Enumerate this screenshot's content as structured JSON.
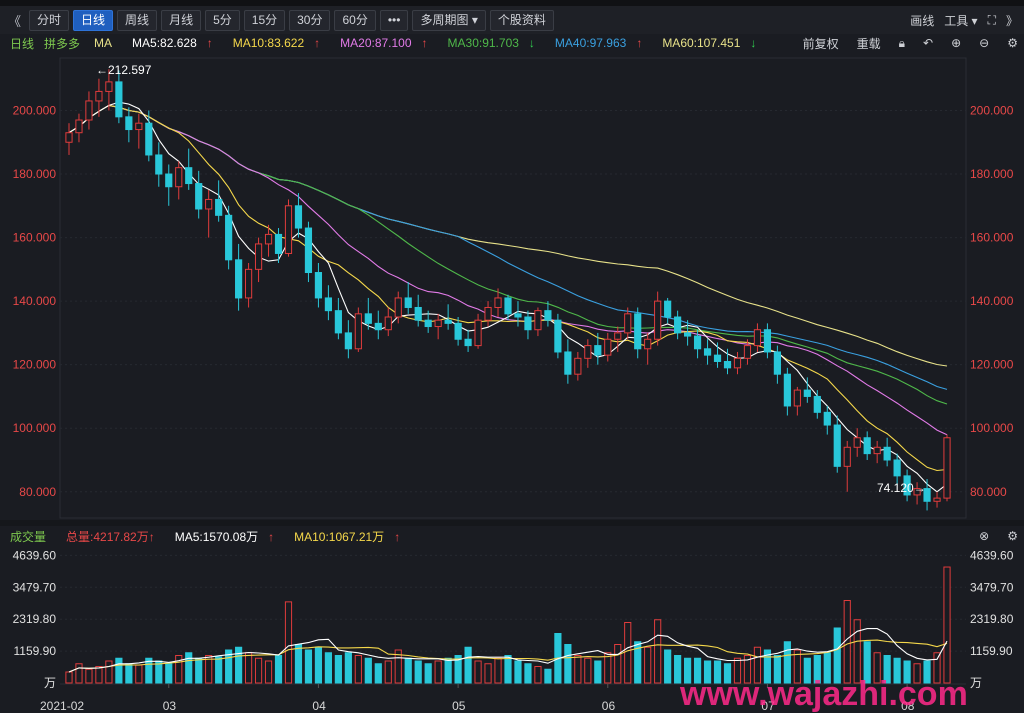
{
  "toolbar": {
    "nav_left": "《",
    "tabs": [
      "分时",
      "日线",
      "周线",
      "月线",
      "5分",
      "15分",
      "30分",
      "60分"
    ],
    "active_tab": 1,
    "more": "•••",
    "multi_period": "多周期图",
    "stock_info": "个股资料",
    "draw_line": "画线",
    "tools": "工具",
    "nav_right": "》"
  },
  "indicators": {
    "period_label": "日线",
    "stock_name": "拼多多",
    "ma_label": "MA",
    "ma5": "MA5:82.628",
    "ma10": "MA10:83.622",
    "ma20": "MA20:87.100",
    "ma30": "MA30:91.703",
    "ma40": "MA40:97.963",
    "ma60": "MA60:107.451",
    "right_labels": [
      "前复权",
      "重载"
    ]
  },
  "colors": {
    "up": "#e03c3c",
    "down": "#29c7d9",
    "ma5": "#ffffff",
    "ma10": "#f5d84b",
    "ma20": "#e27be8",
    "ma30": "#4fb84a",
    "ma40": "#3aa0e0",
    "ma60": "#e8e28a",
    "axis_text": "#e84848",
    "header_green": "#7ec94f"
  },
  "price_axis": {
    "labels": [
      "200.000",
      "180.000",
      "160.000",
      "140.000",
      "120.000",
      "100.000",
      "80.000"
    ],
    "values": [
      200,
      180,
      160,
      140,
      120,
      100,
      80
    ],
    "min": 73,
    "max": 214
  },
  "annotations": {
    "high": "←212.597",
    "low": "74.120→"
  },
  "volume": {
    "title": "成交量",
    "total": "总量:4217.82万",
    "ma5": "MA5:1570.08万",
    "ma10": "MA10:1067.21万",
    "axis_labels": [
      "4639.60",
      "3479.70",
      "2319.80",
      "1159.90",
      "万"
    ],
    "axis_values": [
      4639.6,
      3479.7,
      2319.8,
      1159.9,
      0
    ],
    "max": 4800
  },
  "date_axis": [
    "2021-02",
    "03",
    "04",
    "05",
    "06",
    "07",
    "08"
  ],
  "watermark": "www.wajazhi.com",
  "chart_data": {
    "type": "candlestick",
    "title": "拼多多 日线",
    "high_marker": 212.597,
    "low_marker": 74.12,
    "x": [
      "2021-02",
      "03",
      "04",
      "05",
      "06",
      "07",
      "08"
    ],
    "ohlc": [
      [
        190,
        196,
        186,
        193
      ],
      [
        193,
        199,
        190,
        197
      ],
      [
        197,
        206,
        194,
        203
      ],
      [
        203,
        210,
        198,
        206
      ],
      [
        206,
        213,
        200,
        209
      ],
      [
        209,
        212.6,
        196,
        198
      ],
      [
        198,
        201,
        190,
        194
      ],
      [
        194,
        199,
        188,
        196
      ],
      [
        196,
        200,
        184,
        186
      ],
      [
        186,
        190,
        176,
        180
      ],
      [
        180,
        183,
        170,
        176
      ],
      [
        176,
        184,
        172,
        182
      ],
      [
        182,
        188,
        175,
        177
      ],
      [
        177,
        181,
        166,
        169
      ],
      [
        169,
        175,
        160,
        172
      ],
      [
        172,
        178,
        165,
        167
      ],
      [
        167,
        170,
        150,
        153
      ],
      [
        153,
        158,
        137,
        141
      ],
      [
        141,
        152,
        138,
        150
      ],
      [
        150,
        160,
        146,
        158
      ],
      [
        158,
        164,
        154,
        161
      ],
      [
        161,
        163,
        152,
        155
      ],
      [
        155,
        172,
        154,
        170
      ],
      [
        170,
        174,
        160,
        163
      ],
      [
        163,
        165,
        146,
        149
      ],
      [
        149,
        152,
        138,
        141
      ],
      [
        141,
        145,
        134,
        137
      ],
      [
        137,
        141,
        128,
        130
      ],
      [
        130,
        134,
        122,
        125
      ],
      [
        125,
        138,
        124,
        136
      ],
      [
        136,
        141,
        131,
        133
      ],
      [
        133,
        137,
        128,
        131
      ],
      [
        131,
        138,
        129,
        135
      ],
      [
        135,
        143,
        133,
        141
      ],
      [
        141,
        146,
        136,
        138
      ],
      [
        138,
        142,
        132,
        134
      ],
      [
        134,
        137,
        130,
        132
      ],
      [
        132,
        136,
        128,
        134
      ],
      [
        134,
        139,
        131,
        133
      ],
      [
        133,
        135,
        126,
        128
      ],
      [
        128,
        131,
        124,
        126
      ],
      [
        126,
        136,
        125,
        134
      ],
      [
        134,
        140,
        132,
        138
      ],
      [
        138,
        144,
        135,
        141
      ],
      [
        141,
        142,
        134,
        136
      ],
      [
        136,
        140,
        132,
        135
      ],
      [
        135,
        137,
        128,
        131
      ],
      [
        131,
        138,
        129,
        137
      ],
      [
        137,
        140,
        132,
        134
      ],
      [
        134,
        136,
        122,
        124
      ],
      [
        124,
        128,
        114,
        117
      ],
      [
        117,
        124,
        115,
        122
      ],
      [
        122,
        128,
        119,
        126
      ],
      [
        126,
        130,
        120,
        123
      ],
      [
        123,
        130,
        121,
        128
      ],
      [
        128,
        132,
        124,
        130
      ],
      [
        130,
        138,
        128,
        136
      ],
      [
        136,
        138,
        122,
        125
      ],
      [
        125,
        130,
        120,
        128
      ],
      [
        128,
        143,
        126,
        140
      ],
      [
        140,
        141,
        133,
        135
      ],
      [
        135,
        137,
        128,
        130
      ],
      [
        130,
        134,
        126,
        129
      ],
      [
        129,
        131,
        122,
        125
      ],
      [
        125,
        128,
        120,
        123
      ],
      [
        123,
        127,
        119,
        121
      ],
      [
        121,
        125,
        117,
        119
      ],
      [
        119,
        124,
        117,
        122
      ],
      [
        122,
        128,
        120,
        126
      ],
      [
        126,
        133,
        124,
        131
      ],
      [
        131,
        133,
        122,
        124
      ],
      [
        124,
        126,
        114,
        117
      ],
      [
        117,
        119,
        104,
        107
      ],
      [
        107,
        113,
        104,
        112
      ],
      [
        112,
        116,
        108,
        110
      ],
      [
        110,
        112,
        103,
        105
      ],
      [
        105,
        107,
        98,
        101
      ],
      [
        101,
        104,
        86,
        88
      ],
      [
        88,
        96,
        80,
        94
      ],
      [
        94,
        100,
        91,
        97
      ],
      [
        97,
        99,
        90,
        92
      ],
      [
        92,
        96,
        89,
        94
      ],
      [
        94,
        97,
        88,
        90
      ],
      [
        90,
        92,
        82,
        85
      ],
      [
        85,
        87,
        77,
        79
      ],
      [
        79,
        83,
        76,
        81
      ],
      [
        81,
        84,
        74.12,
        77
      ],
      [
        77,
        80,
        75,
        78
      ],
      [
        78,
        98,
        77,
        97
      ]
    ],
    "volume": [
      400,
      700,
      500,
      600,
      800,
      900,
      700,
      650,
      900,
      800,
      700,
      1000,
      1100,
      900,
      1000,
      950,
      1200,
      1300,
      1100,
      900,
      800,
      1000,
      2950,
      1400,
      1200,
      1300,
      1100,
      1000,
      1100,
      1000,
      900,
      700,
      800,
      1200,
      900,
      800,
      700,
      800,
      900,
      1000,
      1300,
      800,
      700,
      900,
      1000,
      800,
      700,
      600,
      500,
      1800,
      1400,
      1000,
      900,
      800,
      1100,
      1400,
      2200,
      1500,
      1300,
      2300,
      1200,
      1000,
      900,
      900,
      800,
      800,
      700,
      900,
      1000,
      1300,
      1200,
      1000,
      1500,
      1200,
      900,
      1000,
      1100,
      2000,
      3000,
      2300,
      1500,
      1100,
      1000,
      900,
      800,
      700,
      800,
      1100,
      4217
    ]
  }
}
